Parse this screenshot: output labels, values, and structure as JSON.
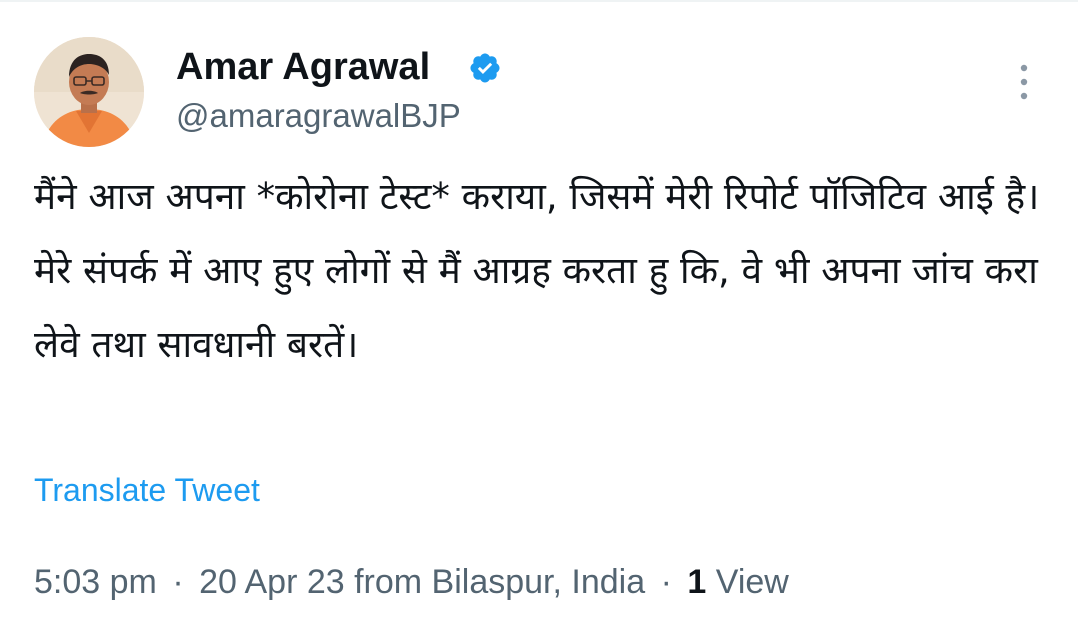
{
  "author": {
    "display_name": "Amar Agrawal",
    "handle": "@amaragrawalBJP",
    "verified": true,
    "verified_color": "#1d9bf0",
    "avatar_icon": "profile-photo"
  },
  "tweet": {
    "text": "मैंने आज अपना *कोरोना टेस्ट* कराया, जिसमें मेरी रिपोर्ट पॉजिटिव आई है। मेरे संपर्क में आए हुए लोगों से मैं आग्रह करता हु कि, वे भी अपना जांच करा लेवे तथा सावधानी बरतें।",
    "translate_label": "Translate Tweet"
  },
  "meta": {
    "time": "5:03 pm",
    "separator": "·",
    "date_source": "20 Apr 23 from Bilaspur, India",
    "views_count": "1",
    "views_label": "View"
  },
  "colors": {
    "text_primary": "#0f1419",
    "text_secondary": "#536471",
    "link": "#1d9bf0"
  },
  "icons": {
    "more": "more-vertical-icon",
    "verified": "verified-badge-icon"
  }
}
